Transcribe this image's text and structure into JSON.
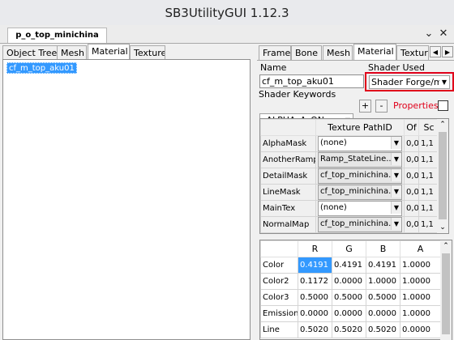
{
  "window": {
    "title": "SB3UtilityGUI 1.12.3",
    "minimize": "⌄",
    "close": "✕"
  },
  "doc_tab": {
    "label": "p_o_top_minichina"
  },
  "left": {
    "tabs": [
      "Object Tree",
      "Mesh",
      "Material",
      "Texture"
    ],
    "active_tab": "Material",
    "list": [
      "cf_m_top_aku01"
    ]
  },
  "right": {
    "tabs": [
      "Frame",
      "Bone",
      "Mesh",
      "Material",
      "Texture"
    ],
    "active_tab": "Material",
    "scroll_left": "◀",
    "scroll_right": "▶",
    "name_label": "Name",
    "name_value": "cf_m_top_aku01",
    "shader_used_label": "Shader Used",
    "shader_used_value": "Shader Forge/m",
    "shader_keywords_label": "Shader Keywords",
    "shader_keywords_value": "_ALPHA_A_ON",
    "add_btn": "+",
    "remove_btn": "-",
    "properties_label": "Properties",
    "highlight_color": "#e0001a",
    "properties_color": "#e0001a"
  },
  "tex_grid": {
    "headers": [
      "",
      "Texture PathID",
      "Of",
      "Sc"
    ],
    "rows": [
      {
        "name": "AlphaMask",
        "texture": "(none)",
        "of": "0,0",
        "sc": "1,1"
      },
      {
        "name": "AnotherRamp",
        "texture": "Ramp_StateLine...",
        "of": "0,0",
        "sc": "1,1"
      },
      {
        "name": "DetailMask",
        "texture": "cf_top_minichina...",
        "of": "0,0",
        "sc": "1,1"
      },
      {
        "name": "LineMask",
        "texture": "cf_top_minichina...",
        "of": "0,0",
        "sc": "1,1"
      },
      {
        "name": "MainTex",
        "texture": "(none)",
        "of": "0,0",
        "sc": "1,1"
      },
      {
        "name": "NormalMap",
        "texture": "cf_top_minichina...",
        "of": "0,0",
        "sc": "1,1"
      }
    ]
  },
  "color_grid": {
    "headers": [
      "",
      "R",
      "G",
      "B",
      "A"
    ],
    "rows": [
      {
        "name": "Color",
        "r": "0.4191",
        "g": "0.4191",
        "b": "0.4191",
        "a": "1.0000"
      },
      {
        "name": "Color2",
        "r": "0.1172",
        "g": "0.0000",
        "b": "1.0000",
        "a": "1.0000"
      },
      {
        "name": "Color3",
        "r": "0.5000",
        "g": "0.5000",
        "b": "0.5000",
        "a": "1.0000"
      },
      {
        "name": "Emission",
        "r": "0.0000",
        "g": "0.0000",
        "b": "0.0000",
        "a": "1.0000"
      },
      {
        "name": "Line",
        "r": "0.5020",
        "g": "0.5020",
        "b": "0.5020",
        "a": "0.0000"
      }
    ],
    "selected_color": "#3399ff"
  }
}
